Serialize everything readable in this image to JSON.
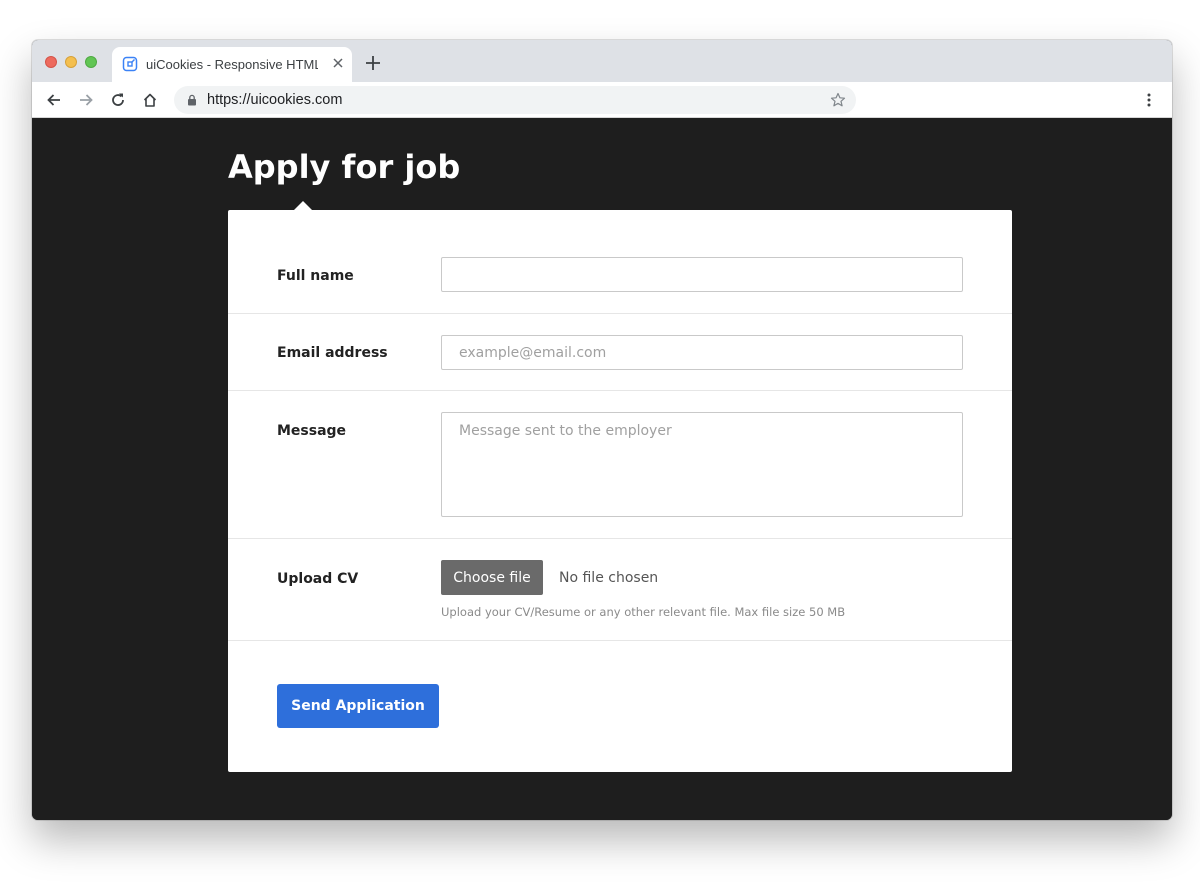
{
  "browser": {
    "tab_title": "uiCookies - Responsive HTML",
    "url": "https://uicookies.com",
    "icons": [
      "favicon-icon",
      "close-icon",
      "plus-icon",
      "back-arrow-icon",
      "forward-arrow-icon",
      "reload-icon",
      "home-icon",
      "lock-icon",
      "star-icon",
      "more-vertical-icon"
    ]
  },
  "page": {
    "title": "Apply for job"
  },
  "form": {
    "full_name": {
      "label": "Full name",
      "value": "",
      "placeholder": ""
    },
    "email": {
      "label": "Email address",
      "value": "",
      "placeholder": "example@email.com"
    },
    "message": {
      "label": "Message",
      "value": "",
      "placeholder": "Message sent to the employer"
    },
    "upload": {
      "label": "Upload CV",
      "button_label": "Choose file",
      "status": "No file chosen",
      "help_text": "Upload your CV/Resume or any other relevant file. Max file size 50 MB"
    },
    "submit_label": "Send Application"
  },
  "colors": {
    "page_background": "#1e1e1e",
    "card_background": "#ffffff",
    "primary_button": "#2e6fdb",
    "file_button": "#6a6a6a"
  }
}
